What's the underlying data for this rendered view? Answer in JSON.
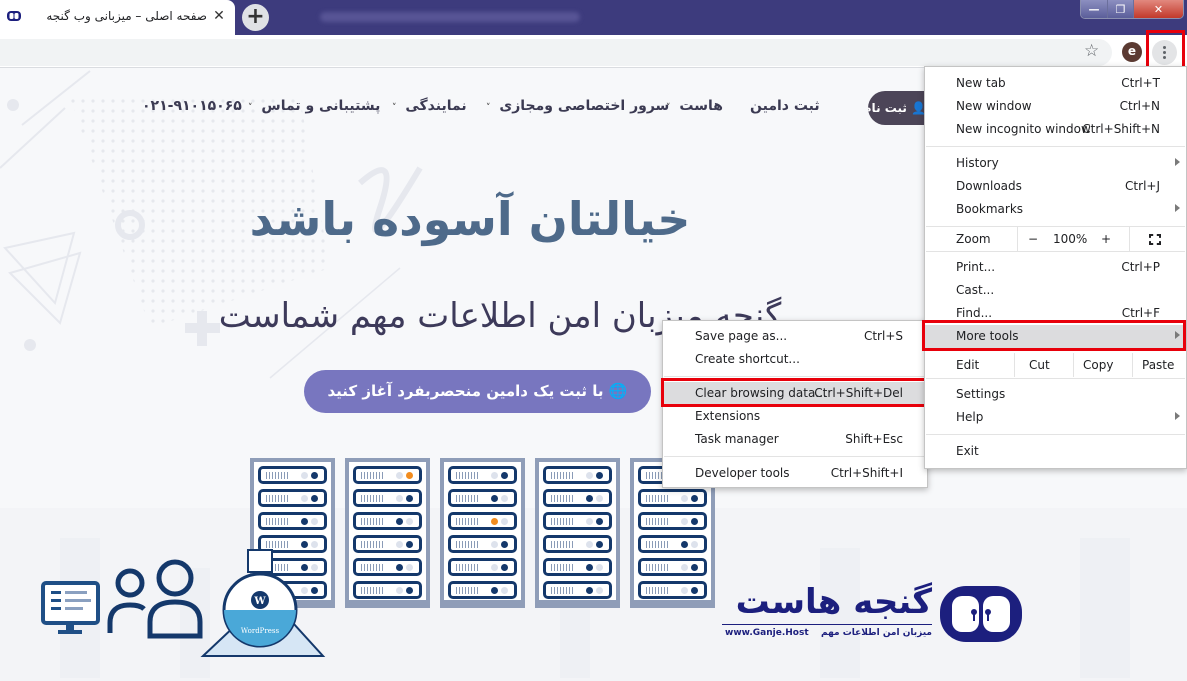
{
  "browser": {
    "tab": {
      "title": "صفحه اصلی – میزبانی وب گنجه",
      "close_glyph": "✕",
      "favicon": "ganje-logo-icon"
    },
    "new_tab_glyph": "+",
    "window_controls": {
      "minimize": "—",
      "restore": "❐",
      "close": "✕"
    },
    "toolbar": {
      "bookmark_icon": "☆",
      "profile_initial": "e",
      "menu_icon": "three-dots-vertical-icon"
    },
    "main_menu": {
      "items": [
        {
          "label": "New tab",
          "shortcut": "Ctrl+T"
        },
        {
          "label": "New window",
          "shortcut": "Ctrl+N"
        },
        {
          "label": "New incognito window",
          "shortcut": "Ctrl+Shift+N"
        },
        {
          "label": "History",
          "shortcut": "",
          "submenu": true
        },
        {
          "label": "Downloads",
          "shortcut": "Ctrl+J"
        },
        {
          "label": "Bookmarks",
          "shortcut": "",
          "submenu": true
        },
        {
          "label": "Print...",
          "shortcut": "Ctrl+P"
        },
        {
          "label": "Cast...",
          "shortcut": ""
        },
        {
          "label": "Find...",
          "shortcut": "Ctrl+F"
        },
        {
          "label": "More tools",
          "shortcut": "",
          "submenu": true,
          "highlighted": true
        },
        {
          "label": "Settings",
          "shortcut": ""
        },
        {
          "label": "Help",
          "shortcut": "",
          "submenu": true
        },
        {
          "label": "Exit",
          "shortcut": ""
        }
      ],
      "zoom": {
        "label": "Zoom",
        "minus": "−",
        "value": "100%",
        "plus": "+",
        "fullscreen_icon": "fullscreen-icon"
      },
      "edit": {
        "label": "Edit",
        "cut": "Cut",
        "copy": "Copy",
        "paste": "Paste"
      }
    },
    "more_tools_menu": {
      "items": [
        {
          "label": "Save page as...",
          "shortcut": "Ctrl+S"
        },
        {
          "label": "Create shortcut...",
          "shortcut": ""
        },
        {
          "label": "Clear browsing data...",
          "shortcut": "Ctrl+Shift+Del",
          "highlighted": true
        },
        {
          "label": "Extensions",
          "shortcut": ""
        },
        {
          "label": "Task manager",
          "shortcut": "Shift+Esc"
        },
        {
          "label": "Developer tools",
          "shortcut": "Ctrl+Shift+I"
        }
      ]
    },
    "annotation_color": "#e8000b"
  },
  "site": {
    "nav": {
      "signup": "ثبت نام",
      "items": [
        {
          "label": "ثبت دامین",
          "dropdown": false
        },
        {
          "label": "هاست",
          "dropdown": true
        },
        {
          "label": "سرور اختصاصی ومجازی",
          "dropdown": true
        },
        {
          "label": "نمایندگی",
          "dropdown": true
        },
        {
          "label": "پشتیبانی و تماس",
          "dropdown": true
        }
      ],
      "phone": "۰۲۱-۹۱۰۱۵۰۶۵",
      "chevron": "˅"
    },
    "hero": {
      "title": "خیالتان آسوده باشد",
      "subtitle": "گنجه میزبان امن اطلاعات مهم شماست",
      "cta": "با ثبت یک دامین منحصربفرد آغاز کنید",
      "cta_icon": "globe-icon"
    },
    "brand": {
      "name": "گنجه هاست",
      "tagline": "میزبان امن اطلاعات مهم",
      "url": "www.Ganje.Host"
    },
    "illustration": {
      "gauge_label": "WordPress"
    },
    "colors": {
      "title": "#4e6a8a",
      "cta": "#7876bf",
      "brand": "#1c1f7e",
      "led_on": "#14386b",
      "led_alert": "#f28c1e"
    }
  }
}
